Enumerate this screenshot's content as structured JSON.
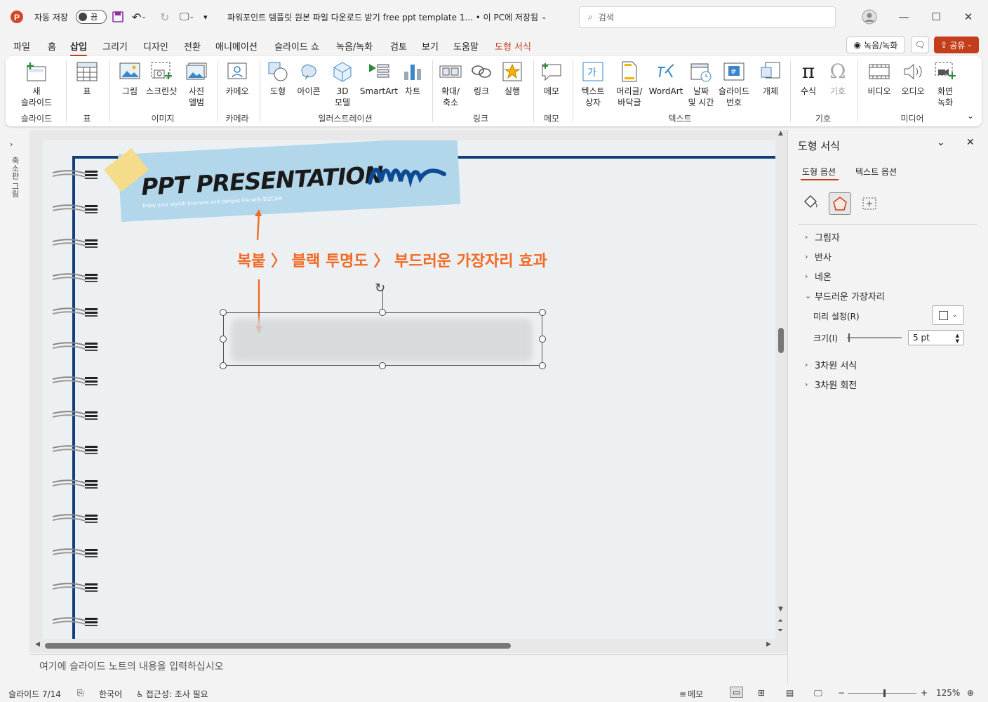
{
  "titlebar": {
    "autosave_label": "자동 저장",
    "autosave_state": "끔",
    "doc_title": "파워포인트 템플릿 원본 파일 다운로드 받기 free ppt template 1...  •  이 PC에 저장됨",
    "search_placeholder": "검색"
  },
  "tabs": [
    "파일",
    "홈",
    "삽입",
    "그리기",
    "디자인",
    "전환",
    "애니메이션",
    "슬라이드 쇼",
    "녹음/녹화",
    "검토",
    "보기",
    "도움말",
    "도형 서식"
  ],
  "active_tab": "삽입",
  "top_buttons": {
    "record": "녹음/녹화",
    "share": "공유"
  },
  "ribbon": {
    "buttons": [
      {
        "label": "새\n슬라이드",
        "icon": "new-slide-icon"
      },
      {
        "label": "표",
        "icon": "table-icon"
      },
      {
        "label": "그림",
        "icon": "picture-icon"
      },
      {
        "label": "스크린샷",
        "icon": "screenshot-icon"
      },
      {
        "label": "사진\n앨범",
        "icon": "photo-album-icon"
      },
      {
        "label": "카메오",
        "icon": "cameo-icon"
      },
      {
        "label": "도형",
        "icon": "shapes-icon"
      },
      {
        "label": "아이콘",
        "icon": "icons-icon"
      },
      {
        "label": "3D\n모델",
        "icon": "3d-model-icon"
      },
      {
        "label": "SmartArt",
        "icon": "smartart-icon"
      },
      {
        "label": "차트",
        "icon": "chart-icon"
      },
      {
        "label": "확대/\n축소",
        "icon": "zoom-icon"
      },
      {
        "label": "링크",
        "icon": "link-icon"
      },
      {
        "label": "실행",
        "icon": "action-icon"
      },
      {
        "label": "메모",
        "icon": "comment-icon"
      },
      {
        "label": "텍스트\n상자",
        "icon": "textbox-icon"
      },
      {
        "label": "머리글/\n바닥글",
        "icon": "header-footer-icon"
      },
      {
        "label": "WordArt",
        "icon": "wordart-icon"
      },
      {
        "label": "날짜\n및 시간",
        "icon": "date-time-icon"
      },
      {
        "label": "슬라이드\n번호",
        "icon": "slide-number-icon"
      },
      {
        "label": "개체",
        "icon": "object-icon"
      },
      {
        "label": "수식",
        "icon": "equation-icon"
      },
      {
        "label": "기호",
        "icon": "symbol-icon"
      },
      {
        "label": "비디오",
        "icon": "video-icon"
      },
      {
        "label": "오디오",
        "icon": "audio-icon"
      },
      {
        "label": "화면\n녹화",
        "icon": "screen-recording-icon"
      }
    ],
    "groups": [
      "슬라이드",
      "표",
      "이미지",
      "카메라",
      "일러스트레이션",
      "링크",
      "메모",
      "텍스트",
      "기호",
      "미디어"
    ]
  },
  "left_strip_label": "축소판 그림",
  "slide": {
    "banner_title": "PPT PRESENTATION",
    "banner_subtitle": "Enjoy your stylish business and campus life with BIZCAM",
    "annotation": "복붙 〉 블랙 투명도 〉 부드러운 가장자리 효과"
  },
  "notes_placeholder": "여기에 슬라이드 노트의 내용을 입력하십시오",
  "pane": {
    "title": "도형 서식",
    "tab1": "도형 옵션",
    "tab2": "텍스트 옵션",
    "sections": [
      "그림자",
      "반사",
      "네온",
      "부드러운 가장자리",
      "3차원 서식",
      "3차원 회전"
    ],
    "preset_label": "미리 설정(R)",
    "size_label": "크기(I)",
    "size_value": "5 pt"
  },
  "status": {
    "slide_info": "슬라이드 7/14",
    "language": "한국어",
    "accessibility": "접근성: 조사 필요",
    "notes": "메모",
    "zoom": "125%"
  },
  "colors": {
    "accent": "#c43e1c",
    "annotation": "#f26a22",
    "banner": "#b2d7ea",
    "navy": "#123f7a"
  }
}
